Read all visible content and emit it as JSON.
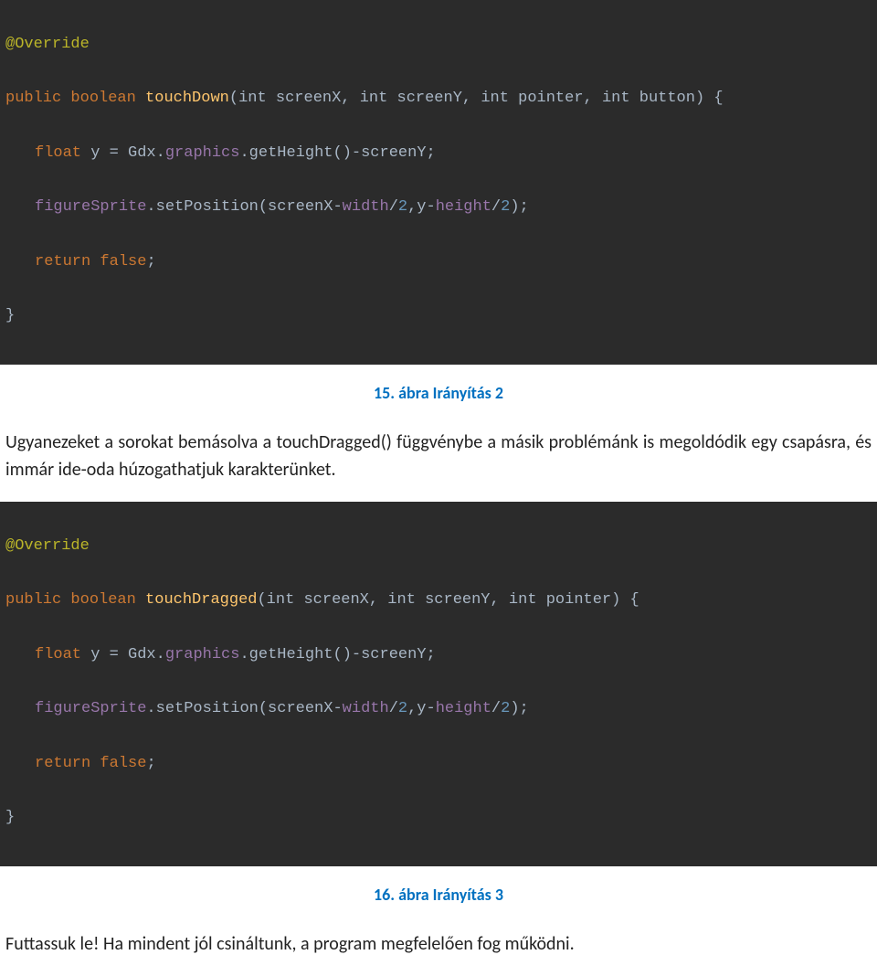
{
  "block1": {
    "annotation": "@Override",
    "sig": {
      "kw_public": "public",
      "kw_boolean": "boolean",
      "method": "touchDown",
      "params": "(int screenX, int screenY, int pointer, int button) {"
    },
    "l1": {
      "kw_float": "float",
      "y": "y",
      "eq": " = ",
      "gdx": "Gdx",
      "dot1": ".",
      "graphics": "graphics",
      "dot2": ".",
      "getH": "getHeight",
      "call": "()-",
      "screenY": "screenY",
      "semi": ";"
    },
    "l2": {
      "fig": "figureSprite",
      "dot": ".",
      "setPos": "setPosition",
      "open": "(",
      "sx": "screenX",
      "minus1": "-",
      "width": "width",
      "slash1": "/",
      "two1": "2",
      "comma": ",",
      "yvar": "y",
      "minus2": "-",
      "height": "height",
      "slash2": "/",
      "two2": "2",
      "close": ");"
    },
    "l3": {
      "kw_return": "return",
      "sp": " ",
      "kw_false": "false",
      "semi": ";"
    },
    "close": "}"
  },
  "caption1": {
    "num": "15.",
    "text": " ábra Irányítás 2"
  },
  "para1": {
    "a": "Ugyanezeket a sorokat bemásolva a touchDragged() függvénybe a másik problémánk is megoldódik egy csapásra, és immár ide-oda húzogathatjuk karakterünket."
  },
  "block2": {
    "annotation": "@Override",
    "sig": {
      "kw_public": "public",
      "kw_boolean": "boolean",
      "method": "touchDragged",
      "params": "(int screenX, int screenY, int pointer) {"
    },
    "l1": {
      "kw_float": "float",
      "y": "y",
      "eq": " = ",
      "gdx": "Gdx",
      "dot1": ".",
      "graphics": "graphics",
      "dot2": ".",
      "getH": "getHeight",
      "call": "()-",
      "screenY": "screenY",
      "semi": ";"
    },
    "l2": {
      "fig": "figureSprite",
      "dot": ".",
      "setPos": "setPosition",
      "open": "(",
      "sx": "screenX",
      "minus1": "-",
      "width": "width",
      "slash1": "/",
      "two1": "2",
      "comma": ",",
      "yvar": "y",
      "minus2": "-",
      "height": "height",
      "slash2": "/",
      "two2": "2",
      "close": ");"
    },
    "l3": {
      "kw_return": "return",
      "sp": " ",
      "kw_false": "false",
      "semi": ";"
    },
    "close": "}"
  },
  "caption2": {
    "num": "16.",
    "text": " ábra Irányítás 3"
  },
  "para2": {
    "a": "Futtassuk le! Ha mindent jól csináltunk, a program megfelelően fog működni."
  }
}
